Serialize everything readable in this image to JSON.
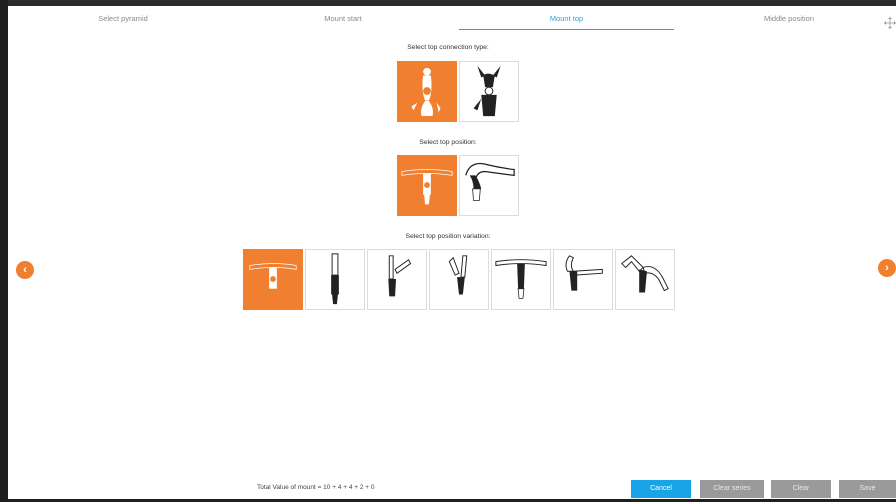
{
  "tabs": [
    {
      "label": "Select pyramid"
    },
    {
      "label": "Mount start"
    },
    {
      "label": "Mount top"
    },
    {
      "label": "Middle position"
    }
  ],
  "active_tab": "Mount top",
  "sections": {
    "connection_type": {
      "label": "Select top connection type:",
      "options": [
        "connection-option-1",
        "connection-option-2"
      ],
      "selected_index": 0
    },
    "position": {
      "label": "Select top position:",
      "options": [
        "position-option-1",
        "position-option-2"
      ],
      "selected_index": 0
    },
    "variation": {
      "label": "Select top position variation:",
      "options": [
        "variation-1",
        "variation-2",
        "variation-3",
        "variation-4",
        "variation-5",
        "variation-6",
        "variation-7"
      ],
      "selected_index": 0
    }
  },
  "navigation": {
    "prev_icon": "chevron-left-icon",
    "next_icon": "chevron-right-icon",
    "prev_glyph": "‹",
    "next_glyph": "›"
  },
  "footer": {
    "total_text": "Total Value of mount = 10 + 4 + 4 + 2 + 0",
    "cancel_label": "Cancel",
    "clear_series_label": "Clear series",
    "clear_label": "Clear",
    "save_label": "Save"
  },
  "colors": {
    "accent_orange": "#f08030",
    "accent_blue": "#1aa4e8",
    "active_tab": "#2aa3d9",
    "disabled_button": "#9a9a9a"
  }
}
